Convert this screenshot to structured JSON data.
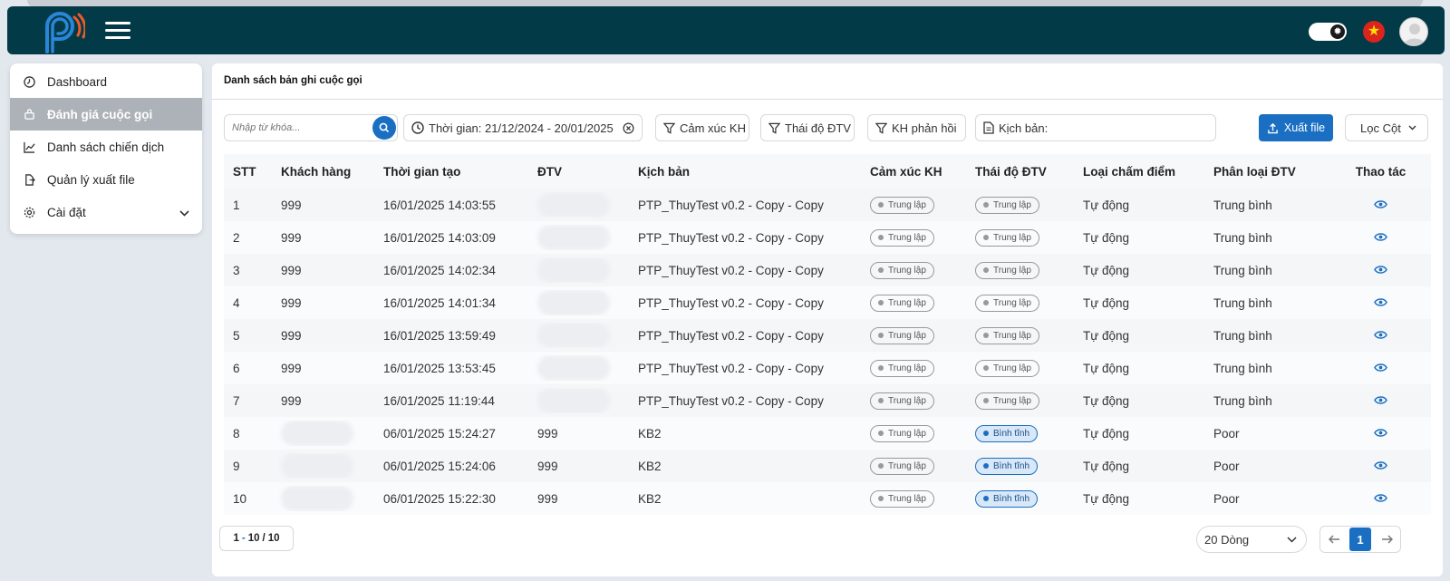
{
  "header": {
    "language_flag": "vn-flag"
  },
  "sidebar": {
    "items": [
      {
        "label": "Dashboard",
        "icon": "dashboard-icon"
      },
      {
        "label": "Đánh giá cuộc gọi",
        "icon": "call-review-icon",
        "active": true
      },
      {
        "label": "Danh sách chiến dịch",
        "icon": "chart-icon"
      },
      {
        "label": "Quản lý xuất file",
        "icon": "file-export-icon"
      },
      {
        "label": "Cài đặt",
        "icon": "settings-icon",
        "has_submenu": true
      }
    ]
  },
  "main": {
    "title": "Danh sách bản ghi cuộc gọi",
    "filters": {
      "search_placeholder": "Nhập từ khóa...",
      "time_range": "Thời gian: 21/12/2024 - 20/01/2025",
      "emotion": "Cảm xúc KH",
      "attitude": "Thái độ ĐTV",
      "feedback": "KH phản hồi",
      "script": "Kịch bản:",
      "export": "Xuất file",
      "columns": "Lọc Cột"
    },
    "table": {
      "headers": [
        "STT",
        "Khách hàng",
        "Thời gian tạo",
        "ĐTV",
        "Kịch bản",
        "Cảm xúc KH",
        "Thái độ ĐTV",
        "Loại chấm điểm",
        "Phân loại ĐTV",
        "Thao tác"
      ],
      "rows": [
        [
          "1",
          "999",
          "16/01/2025 14:03:55",
          "",
          "PTP_ThuyTest v0.2 - Copy - Copy",
          "Trung lập",
          "Trung lập",
          "Tự động",
          "Trung bình"
        ],
        [
          "2",
          "999",
          "16/01/2025 14:03:09",
          "",
          "PTP_ThuyTest v0.2 - Copy - Copy",
          "Trung lập",
          "Trung lập",
          "Tự động",
          "Trung bình"
        ],
        [
          "3",
          "999",
          "16/01/2025 14:02:34",
          "",
          "PTP_ThuyTest v0.2 - Copy - Copy",
          "Trung lập",
          "Trung lập",
          "Tự động",
          "Trung bình"
        ],
        [
          "4",
          "999",
          "16/01/2025 14:01:34",
          "",
          "PTP_ThuyTest v0.2 - Copy - Copy",
          "Trung lập",
          "Trung lập",
          "Tự động",
          "Trung bình"
        ],
        [
          "5",
          "999",
          "16/01/2025 13:59:49",
          "",
          "PTP_ThuyTest v0.2 - Copy - Copy",
          "Trung lập",
          "Trung lập",
          "Tự động",
          "Trung bình"
        ],
        [
          "6",
          "999",
          "16/01/2025 13:53:45",
          "",
          "PTP_ThuyTest v0.2 - Copy - Copy",
          "Trung lập",
          "Trung lập",
          "Tự động",
          "Trung bình"
        ],
        [
          "7",
          "999",
          "16/01/2025 11:19:44",
          "",
          "PTP_ThuyTest v0.2 - Copy - Copy",
          "Trung lập",
          "Trung lập",
          "Tự động",
          "Trung bình"
        ],
        [
          "8",
          "",
          "06/01/2025 15:24:27",
          "999",
          "KB2",
          "Trung lập",
          "Bình tĩnh",
          "Tự động",
          "Poor"
        ],
        [
          "9",
          "",
          "06/01/2025 15:24:06",
          "999",
          "KB2",
          "Trung lập",
          "Bình tĩnh",
          "Tự động",
          "Poor"
        ],
        [
          "10",
          "",
          "06/01/2025 15:22:30",
          "999",
          "KB2",
          "Trung lập",
          "Bình tĩnh",
          "Tự động",
          "Poor"
        ]
      ]
    },
    "pagination": {
      "range_start": "1",
      "range_end": "10",
      "total": "10",
      "rows_per_page": "20 Dòng",
      "current_page": "1"
    }
  },
  "colors": {
    "header_bg": "#023a47",
    "accent": "#1a6fc2",
    "active_menu": "#adb2b8"
  }
}
